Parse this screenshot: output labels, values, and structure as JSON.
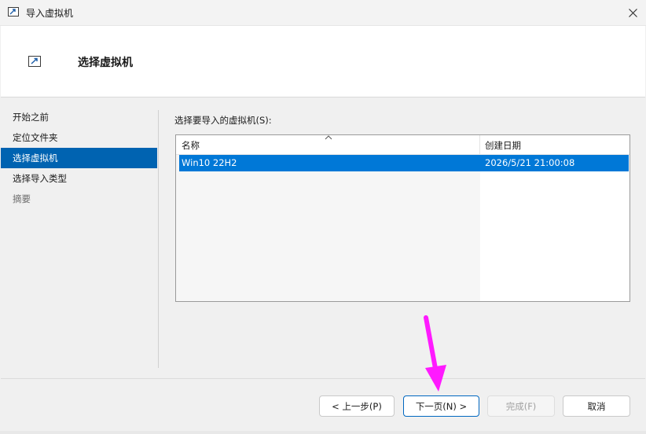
{
  "window": {
    "title": "导入虚拟机"
  },
  "header": {
    "title": "选择虚拟机"
  },
  "nav": {
    "items": [
      {
        "label": "开始之前",
        "state": "normal"
      },
      {
        "label": "定位文件夹",
        "state": "normal"
      },
      {
        "label": "选择虚拟机",
        "state": "selected"
      },
      {
        "label": "选择导入类型",
        "state": "normal"
      },
      {
        "label": "摘要",
        "state": "disabled"
      }
    ]
  },
  "main": {
    "list_label": "选择要导入的虚拟机(S):",
    "columns": [
      "名称",
      "创建日期"
    ],
    "rows": [
      {
        "name": "Win10 22H2",
        "created": "2026/5/21 21:00:08",
        "selected": true
      }
    ]
  },
  "buttons": {
    "prev": "< 上一步(P)",
    "next": "下一页(N) >",
    "finish": "完成(F)",
    "cancel": "取消"
  },
  "colors": {
    "selection": "#0078d7",
    "nav_selection": "#0063b1",
    "annotation_arrow": "#ff1aff"
  }
}
